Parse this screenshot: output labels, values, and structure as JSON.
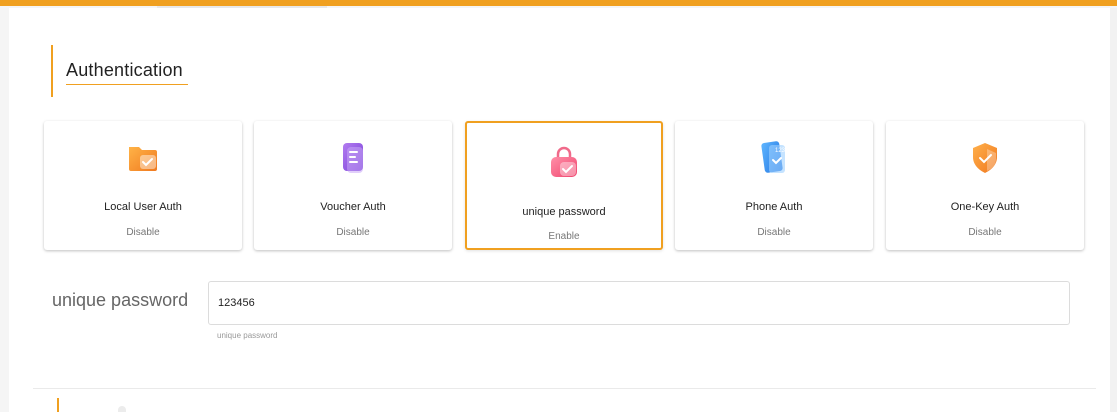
{
  "colors": {
    "accent": "#f0a020",
    "selected_border": "#f0a020"
  },
  "section": {
    "title": "Authentication"
  },
  "auth_methods": [
    {
      "name": "Local User Auth",
      "status": "Disable",
      "icon": "folder-check-icon",
      "selected": false
    },
    {
      "name": "Voucher Auth",
      "status": "Disable",
      "icon": "voucher-document-icon",
      "selected": false
    },
    {
      "name": "unique password",
      "status": "Enable",
      "icon": "lock-bag-icon",
      "selected": true
    },
    {
      "name": "Phone Auth",
      "status": "Disable",
      "icon": "phone-check-icon",
      "selected": false
    },
    {
      "name": "One-Key Auth",
      "status": "Disable",
      "icon": "shield-check-icon",
      "selected": false
    }
  ],
  "password_field": {
    "label": "unique password",
    "value": "123456",
    "hint": "unique password"
  }
}
